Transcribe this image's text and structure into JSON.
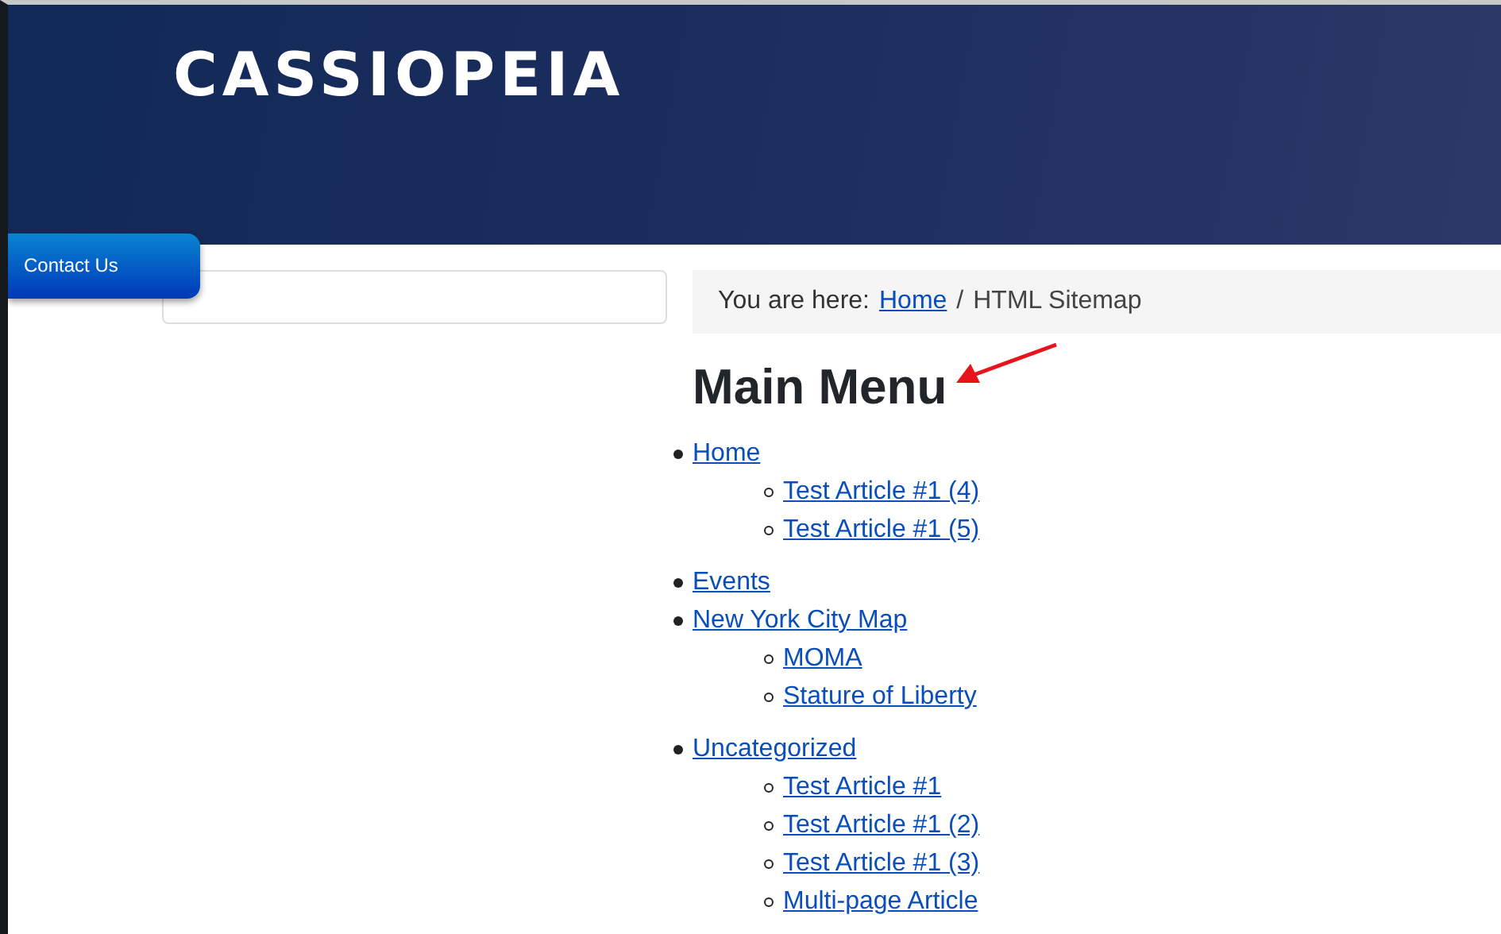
{
  "header": {
    "logo": "CASSIOPEIA"
  },
  "contact_tab": {
    "label": "Contact Us"
  },
  "breadcrumb": {
    "prefix": "You are here:",
    "separator": "/",
    "items": [
      {
        "label": "Home",
        "kind": "link"
      },
      {
        "label": "HTML Sitemap",
        "kind": "current"
      }
    ]
  },
  "heading": "Main Menu",
  "menu": [
    {
      "label": "Home",
      "children": [
        {
          "label": "Test Article #1 (4)"
        },
        {
          "label": "Test Article #1 (5)"
        }
      ]
    },
    {
      "label": "Events"
    },
    {
      "label": "New York City Map",
      "children": [
        {
          "label": "MOMA"
        },
        {
          "label": "Stature of Liberty"
        }
      ]
    },
    {
      "label": "Uncategorized",
      "children": [
        {
          "label": "Test Article #1"
        },
        {
          "label": "Test Article #1 (2)"
        },
        {
          "label": "Test Article #1 (3)"
        },
        {
          "label": "Multi-page Article"
        }
      ]
    }
  ]
}
